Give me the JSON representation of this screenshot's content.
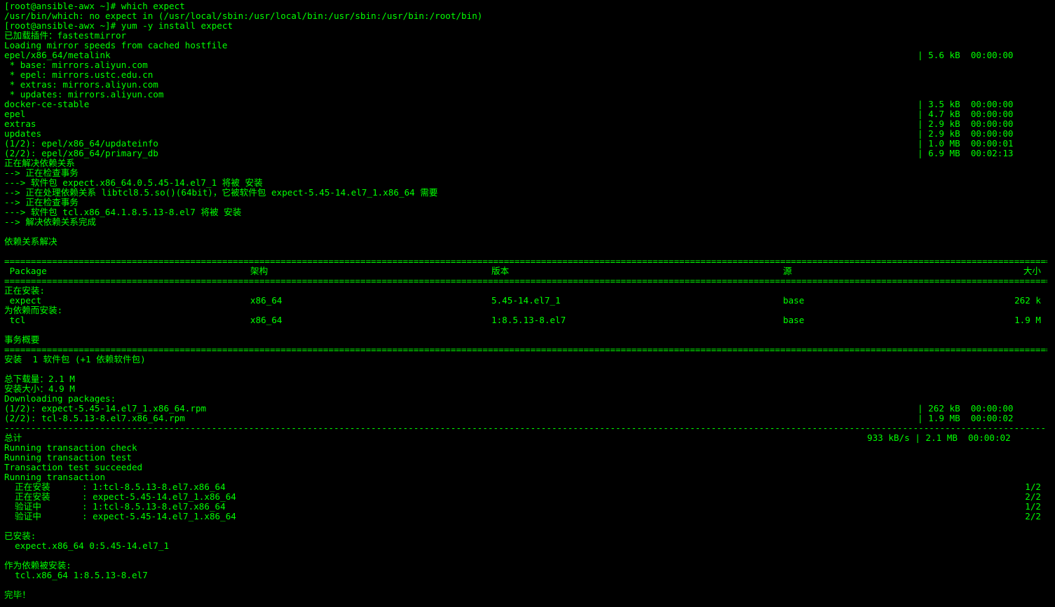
{
  "terminal": {
    "fg": "#00ff00",
    "bg": "#000000",
    "prompt1": "[root@ansible-awx ~]# which expect",
    "which_result": "/usr/bin/which: no expect in (/usr/local/sbin:/usr/local/bin:/usr/sbin:/usr/bin:/root/bin)",
    "prompt2": "[root@ansible-awx ~]# yum -y install expect",
    "plugins": "已加载插件：fastestmirror",
    "loading": "Loading mirror speeds from cached hostfile",
    "repo_lines": [
      {
        "name": "epel/x86_64/metalink",
        "size": "| 5.6 kB  00:00:00"
      },
      {
        "name": " * base: mirrors.aliyun.com",
        "size": ""
      },
      {
        "name": " * epel: mirrors.ustc.edu.cn",
        "size": ""
      },
      {
        "name": " * extras: mirrors.aliyun.com",
        "size": ""
      },
      {
        "name": " * updates: mirrors.aliyun.com",
        "size": ""
      },
      {
        "name": "docker-ce-stable",
        "size": "| 3.5 kB  00:00:00"
      },
      {
        "name": "epel",
        "size": "| 4.7 kB  00:00:00"
      },
      {
        "name": "extras",
        "size": "| 2.9 kB  00:00:00"
      },
      {
        "name": "updates",
        "size": "| 2.9 kB  00:00:00"
      },
      {
        "name": "(1/2): epel/x86_64/updateinfo",
        "size": "| 1.0 MB  00:00:01"
      },
      {
        "name": "(2/2): epel/x86_64/primary_db",
        "size": "| 6.9 MB  00:02:13"
      }
    ],
    "deps_lines": [
      "正在解决依赖关系",
      "--> 正在检查事务",
      "---> 软件包 expect.x86_64.0.5.45-14.el7_1 将被 安装",
      "--> 正在处理依赖关系 libtcl8.5.so()(64bit)，它被软件包 expect-5.45-14.el7_1.x86_64 需要",
      "--> 正在检查事务",
      "---> 软件包 tcl.x86_64.1.8.5.13-8.el7 将被 安装",
      "--> 解决依赖关系完成",
      "",
      "依赖关系解决"
    ],
    "separator_eq": "=================================================================================================================================================================================================================================================================================",
    "separator_dash": "---------------------------------------------------------------------------------------------------------------------------------------------------------------------------------------------------------------------------------------------------------------------------------",
    "table_header": {
      "package": " Package",
      "arch": "架构",
      "version": "版本",
      "repo": "源",
      "size": "大小"
    },
    "installing_label": "正在安装:",
    "dep_installing_label": "为依赖而安装:",
    "packages": [
      {
        "name": " expect",
        "arch": "x86_64",
        "version": "5.45-14.el7_1",
        "repo": "base",
        "size": "262 k"
      },
      {
        "name": " tcl",
        "arch": "x86_64",
        "version": "1:8.5.13-8.el7",
        "repo": "base",
        "size": "1.9 M"
      }
    ],
    "summary_label": "事务概要",
    "install_summary": "安装  1 软件包 (+1 依赖软件包)",
    "total_download": "总下载量：2.1 M",
    "install_size": "安装大小：4.9 M",
    "downloading": "Downloading packages:",
    "download_lines": [
      {
        "name": "(1/2): expect-5.45-14.el7_1.x86_64.rpm",
        "size": "| 262 kB  00:00:00"
      },
      {
        "name": "(2/2): tcl-8.5.13-8.el7.x86_64.rpm",
        "size": "| 1.9 MB  00:00:02"
      }
    ],
    "total_label": "总计",
    "total_stats": "933 kB/s | 2.1 MB  00:00:02",
    "transaction_lines": [
      "Running transaction check",
      "Running transaction test",
      "Transaction test succeeded",
      "Running transaction"
    ],
    "steps": [
      {
        "action": "  正在安装    ",
        "pkg": ": 1:tcl-8.5.13-8.el7.x86_64",
        "count": "1/2"
      },
      {
        "action": "  正在安装    ",
        "pkg": ": expect-5.45-14.el7_1.x86_64",
        "count": "2/2"
      },
      {
        "action": "  验证中      ",
        "pkg": ": 1:tcl-8.5.13-8.el7.x86_64",
        "count": "1/2"
      },
      {
        "action": "  验证中      ",
        "pkg": ": expect-5.45-14.el7_1.x86_64",
        "count": "2/2"
      }
    ],
    "installed_label": "已安装:",
    "installed_pkg": "  expect.x86_64 0:5.45-14.el7_1",
    "dep_installed_label": "作为依赖被安装:",
    "dep_installed_pkg": "  tcl.x86_64 1:8.5.13-8.el7",
    "done": "完毕！"
  }
}
